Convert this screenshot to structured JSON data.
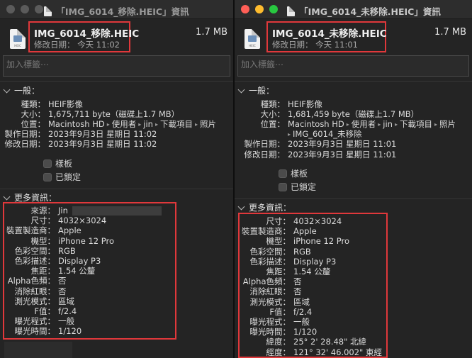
{
  "left": {
    "title": "「IMG_6014_移除.HEIC」資訊",
    "filename": "IMG_6014_移除.HEIC",
    "modified_short": "修改日期： 今天 11:02",
    "size": "1.7 MB",
    "tags_placeholder": "加入標籤⋯",
    "general_header": "一般：",
    "general": [
      {
        "k": "種類：",
        "v": "HEIF影像"
      },
      {
        "k": "大小：",
        "v": "1,675,711 byte（磁碟上1.7 MB）"
      },
      {
        "k": "位置：",
        "path": [
          "Macintosh HD",
          "使用者",
          "jin",
          "下載項目",
          "照片"
        ]
      },
      {
        "k": "製作日期：",
        "v": "2023年9月3日 星期日 11:02"
      },
      {
        "k": "修改日期：",
        "v": "2023年9月3日 星期日 11:02"
      }
    ],
    "stationery": "樣板",
    "locked": "已鎖定",
    "more_header": "更多資訊：",
    "more": [
      {
        "k": "來源：",
        "v": "Jin"
      },
      {
        "k": "尺寸：",
        "v": "4032×3024"
      },
      {
        "k": "裝置製造商：",
        "v": "Apple"
      },
      {
        "k": "機型：",
        "v": "iPhone 12 Pro"
      },
      {
        "k": "色彩空間：",
        "v": "RGB"
      },
      {
        "k": "色彩描述：",
        "v": "Display P3"
      },
      {
        "k": "焦距：",
        "v": "1.54 公釐"
      },
      {
        "k": "Alpha色頻：",
        "v": "否"
      },
      {
        "k": "消除紅眼：",
        "v": "否"
      },
      {
        "k": "測光模式：",
        "v": "區域"
      },
      {
        "k": "F值：",
        "v": "f/2.4"
      },
      {
        "k": "曝光程式：",
        "v": "一般"
      },
      {
        "k": "曝光時間：",
        "v": "1/120"
      }
    ]
  },
  "right": {
    "title": "「IMG_6014_未移除.HEIC」資訊",
    "filename": "IMG_6014_未移除.HEIC",
    "modified_short": "修改日期： 今天 11:01",
    "size": "1.7 MB",
    "tags_placeholder": "加入標籤⋯",
    "general_header": "一般：",
    "general": [
      {
        "k": "種類：",
        "v": "HEIF影像"
      },
      {
        "k": "大小：",
        "v": "1,681,459 byte（磁碟上1.7 MB）"
      },
      {
        "k": "位置：",
        "path": [
          "Macintosh HD",
          "使用者",
          "jin",
          "下載項目",
          "照片"
        ],
        "path2": "IMG_6014_未移除"
      },
      {
        "k": "製作日期：",
        "v": "2023年9月3日 星期日 11:01"
      },
      {
        "k": "修改日期：",
        "v": "2023年9月3日 星期日 11:01"
      }
    ],
    "stationery": "樣板",
    "locked": "已鎖定",
    "more_header": "更多資訊：",
    "more": [
      {
        "k": "尺寸：",
        "v": "4032×3024"
      },
      {
        "k": "裝置製造商：",
        "v": "Apple"
      },
      {
        "k": "機型：",
        "v": "iPhone 12 Pro"
      },
      {
        "k": "色彩空間：",
        "v": "RGB"
      },
      {
        "k": "色彩描述：",
        "v": "Display P3"
      },
      {
        "k": "焦距：",
        "v": "1.54 公釐"
      },
      {
        "k": "Alpha色頻：",
        "v": "否"
      },
      {
        "k": "消除紅眼：",
        "v": "否"
      },
      {
        "k": "測光模式：",
        "v": "區域"
      },
      {
        "k": "F值：",
        "v": "f/2.4"
      },
      {
        "k": "曝光程式：",
        "v": "一般"
      },
      {
        "k": "曝光時間：",
        "v": "1/120"
      },
      {
        "k": "緯度：",
        "v": "25° 2' 28.48\" 北緯"
      },
      {
        "k": "經度：",
        "v": "121° 32' 46.002\" 東經"
      }
    ]
  }
}
